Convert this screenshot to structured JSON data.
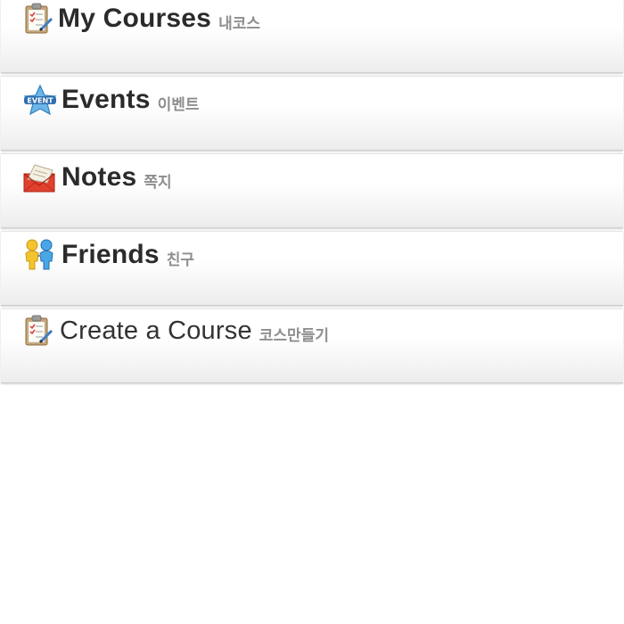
{
  "menu": {
    "items": [
      {
        "title": "My Courses",
        "subtitle": "내코스",
        "icon": "clipboard-checklist-icon"
      },
      {
        "title": "Events",
        "subtitle": "이벤트",
        "icon": "event-star-icon"
      },
      {
        "title": "Notes",
        "subtitle": "쪽지",
        "icon": "envelope-letter-icon"
      },
      {
        "title": "Friends",
        "subtitle": "친구",
        "icon": "friends-people-icon"
      },
      {
        "title": "Create a Course",
        "subtitle": "코스만들기",
        "icon": "clipboard-checklist-icon"
      }
    ]
  },
  "colors": {
    "title": "#2b2b2b",
    "subtitle": "#8e8e8e",
    "event_star": "#5aa9e0",
    "envelope": "#e2402e",
    "friend_yellow": "#f2c12e",
    "friend_blue": "#3a9be0"
  }
}
